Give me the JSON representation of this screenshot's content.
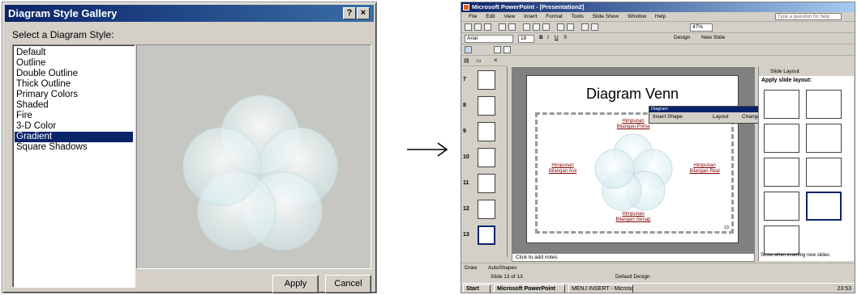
{
  "dialog": {
    "title": "Diagram Style Gallery",
    "help_btn": "?",
    "close_btn": "×",
    "select_label": "Select a Diagram Style:",
    "styles": [
      "Default",
      "Outline",
      "Double Outline",
      "Thick Outline",
      "Primary Colors",
      "Shaded",
      "Fire",
      "3-D Color",
      "Gradient",
      "Square Shadows"
    ],
    "selected_style": "Gradient",
    "apply_label": "Apply",
    "cancel_label": "Cancel"
  },
  "arrow": "→",
  "ppt": {
    "title": "Microsoft PowerPoint - [Presentation2]",
    "menu": [
      "File",
      "Edit",
      "View",
      "Insert",
      "Format",
      "Tools",
      "Slide Show",
      "Window",
      "Help"
    ],
    "help_placeholder": "Type a question for help",
    "font_name": "Arial",
    "font_size": "18",
    "zoom": "47%",
    "design_btn": "Design",
    "new_slide_btn": "New Slide",
    "thumb_numbers": [
      "7",
      "8",
      "9",
      "10",
      "11",
      "12",
      "13"
    ],
    "slide_title": "Diagram Venn",
    "venn_labels": {
      "top": "Himpunan\nBilangan Prima",
      "left": "Himpunan\nBilangan Asli",
      "right": "Himpunan\nBilangan Real",
      "bottom": "Himpunan\nBilangan Genap"
    },
    "slide_page_number": "13",
    "diagram_toolbar": {
      "caption": "Diagram",
      "insert_shape": "Insert Shape",
      "layout": "Layout",
      "change_to": "Change to"
    },
    "notes_placeholder": "Click to add notes",
    "taskpane": {
      "header": "Slide Layout",
      "apply_label": "Apply slide layout:",
      "footer": "Show when inserting new slides"
    },
    "draw_bar": {
      "draw": "Draw",
      "autoshapes": "AutoShapes"
    },
    "status": {
      "slide": "Slide 13 of 13",
      "design": "Default Design"
    },
    "taskbar": {
      "start": "Start",
      "app1": "Microsoft PowerPoint",
      "app2": "MENJ INSERT - Microsoft...",
      "clock": "23:53"
    }
  }
}
